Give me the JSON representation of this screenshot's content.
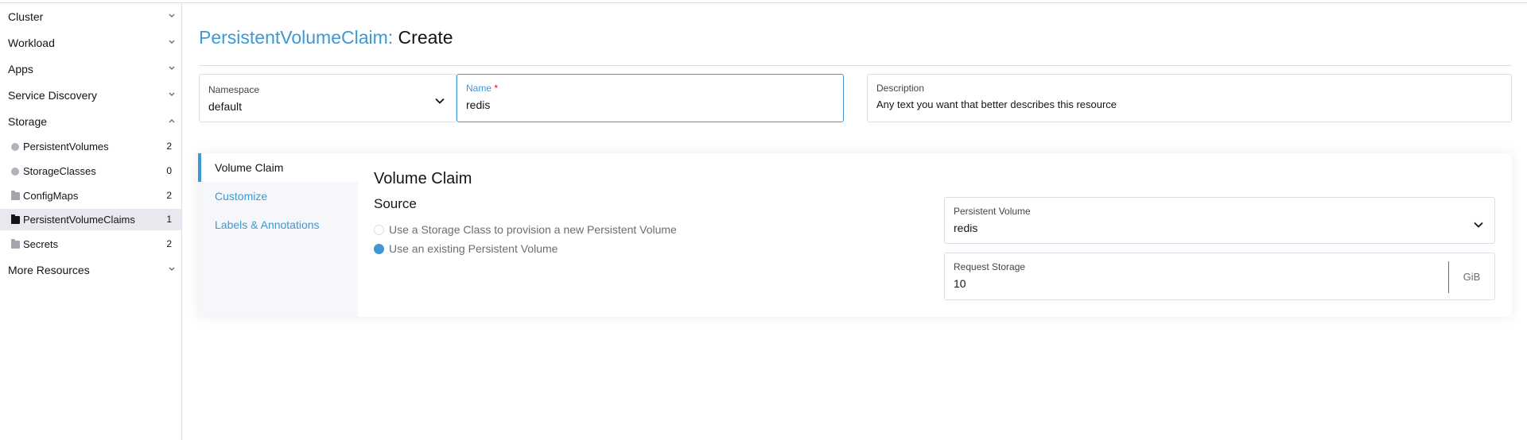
{
  "sidebar": {
    "groups": [
      {
        "label": "Cluster"
      },
      {
        "label": "Workload"
      },
      {
        "label": "Apps"
      },
      {
        "label": "Service Discovery"
      },
      {
        "label": "Storage"
      },
      {
        "label": "More Resources"
      }
    ],
    "storage_items": [
      {
        "label": "PersistentVolumes",
        "count": "2",
        "icon": "circle-icon"
      },
      {
        "label": "StorageClasses",
        "count": "0",
        "icon": "circle-icon"
      },
      {
        "label": "ConfigMaps",
        "count": "2",
        "icon": "folder-icon"
      },
      {
        "label": "PersistentVolumeClaims",
        "count": "1",
        "icon": "folder-icon"
      },
      {
        "label": "Secrets",
        "count": "2",
        "icon": "folder-icon"
      }
    ]
  },
  "header": {
    "resource": "PersistentVolumeClaim:",
    "action": "Create"
  },
  "form": {
    "namespace": {
      "label": "Namespace",
      "value": "default"
    },
    "name": {
      "label": "Name",
      "required_mark": "*",
      "value": "redis"
    },
    "description": {
      "label": "Description",
      "placeholder": "Any text you want that better describes this resource"
    }
  },
  "tabs": [
    {
      "label": "Volume Claim"
    },
    {
      "label": "Customize"
    },
    {
      "label": "Labels & Annotations"
    }
  ],
  "volume_claim": {
    "title": "Volume Claim",
    "source_title": "Source",
    "options": [
      {
        "label": "Use a Storage Class to provision a new Persistent Volume",
        "selected": false
      },
      {
        "label": "Use an existing Persistent Volume",
        "selected": true
      }
    ],
    "persistent_volume": {
      "label": "Persistent Volume",
      "value": "redis"
    },
    "request_storage": {
      "label": "Request Storage",
      "value": "10",
      "unit": "GiB"
    }
  },
  "colors": {
    "accent": "#3d98d3",
    "border": "#dcdee7",
    "active_nav": "#e8e9ef"
  }
}
